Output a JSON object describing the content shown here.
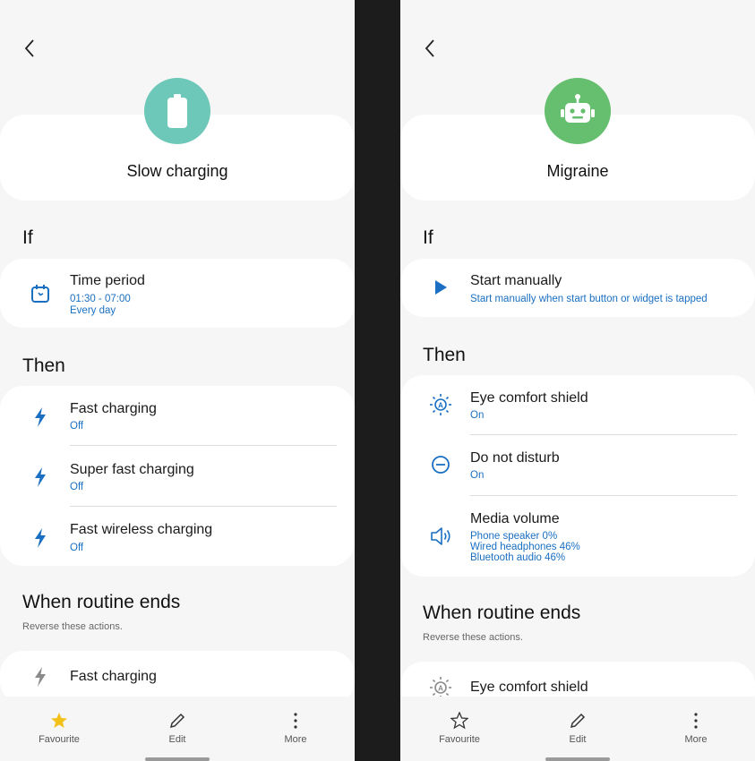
{
  "left": {
    "title": "Slow charging",
    "icon_color": "#6ec8b9",
    "hero_icon": "battery-icon",
    "sections": {
      "if": "If",
      "then": "Then",
      "ends": "When routine ends",
      "ends_note": "Reverse these actions."
    },
    "if_item": {
      "icon": "calendar-icon",
      "title": "Time period",
      "sub": [
        "01:30 - 07:00",
        "Every day"
      ]
    },
    "then_items": [
      {
        "icon": "bolt-icon",
        "title": "Fast charging",
        "sub": "Off"
      },
      {
        "icon": "bolt-icon",
        "title": "Super fast charging",
        "sub": "Off"
      },
      {
        "icon": "bolt-icon",
        "title": "Fast wireless charging",
        "sub": "Off"
      }
    ],
    "end_item": {
      "icon": "bolt-icon",
      "title": "Fast charging"
    }
  },
  "right": {
    "title": "Migraine",
    "icon_color": "#66bf6e",
    "hero_icon": "robot-icon",
    "sections": {
      "if": "If",
      "then": "Then",
      "ends": "When routine ends",
      "ends_note": "Reverse these actions."
    },
    "if_item": {
      "icon": "play-icon",
      "title": "Start manually",
      "sub": [
        "Start manually when start button or widget is tapped"
      ]
    },
    "then_items": [
      {
        "icon": "eye-comfort-icon",
        "title": "Eye comfort shield",
        "sub": [
          "On"
        ]
      },
      {
        "icon": "do-not-disturb-icon",
        "title": "Do not disturb",
        "sub": [
          "On"
        ]
      },
      {
        "icon": "volume-icon",
        "title": "Media volume",
        "sub": [
          "Phone speaker 0%",
          "Wired headphones 46%",
          "Bluetooth audio 46%"
        ]
      }
    ],
    "end_item": {
      "icon": "eye-comfort-icon",
      "title": "Eye comfort shield"
    }
  },
  "nav": {
    "favourite": "Favourite",
    "edit": "Edit",
    "more": "More"
  },
  "colors": {
    "accent_blue": "#1a6fc2",
    "star_yellow": "#f2c21b"
  }
}
